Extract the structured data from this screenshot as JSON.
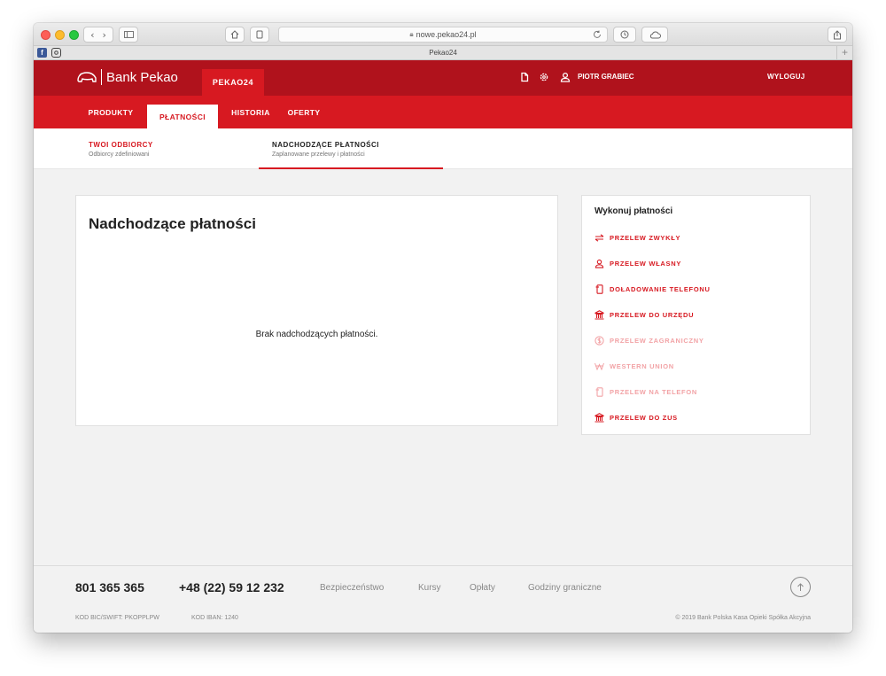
{
  "browser": {
    "url": "nowe.pekao24.pl",
    "tab_title": "Pekao24",
    "new_tab": "+"
  },
  "header": {
    "brand": "Bank Pekao",
    "product_tab": "PEKAO24",
    "user_name": "PIOTR GRABIEC",
    "logout": "WYLOGUJ",
    "icons": [
      "document-icon",
      "settings-icon",
      "user-icon"
    ]
  },
  "nav": {
    "items": [
      "PRODUKTY",
      "PŁATNOŚCI",
      "HISTORIA",
      "OFERTY"
    ],
    "active": "PŁATNOŚCI"
  },
  "subnav": {
    "items": [
      {
        "title": "TWOI ODBIORCY",
        "subtitle": "Odbiorcy zdefiniowani"
      },
      {
        "title": "NADCHODZĄCE PŁATNOŚCI",
        "subtitle": "Zaplanowane przelewy i płatności"
      }
    ],
    "active": "NADCHODZĄCE PŁATNOŚCI"
  },
  "main": {
    "title": "Nadchodzące płatności",
    "empty_message": "Brak nadchodzących płatności."
  },
  "sidebar": {
    "title": "Wykonuj płatności",
    "actions": [
      {
        "label": "PRZELEW ZWYKŁY",
        "icon": "transfer-arrows-icon",
        "enabled": true
      },
      {
        "label": "PRZELEW WŁASNY",
        "icon": "user-icon",
        "enabled": true
      },
      {
        "label": "DOŁADOWANIE TELEFONU",
        "icon": "phone-topup-icon",
        "enabled": true
      },
      {
        "label": "PRZELEW DO URZĘDU",
        "icon": "office-building-icon",
        "enabled": true
      },
      {
        "label": "PRZELEW ZAGRANICZNY",
        "icon": "currency-icon",
        "enabled": false
      },
      {
        "label": "WESTERN UNION",
        "icon": "western-union-icon",
        "enabled": false
      },
      {
        "label": "PRZELEW NA TELEFON",
        "icon": "phone-transfer-icon",
        "enabled": false
      },
      {
        "label": "PRZELEW DO ZUS",
        "icon": "office-building-icon",
        "enabled": true
      }
    ]
  },
  "footer": {
    "phone_primary": "801 365 365",
    "phone_secondary": "+48 (22) 59 12 232",
    "links": [
      "Bezpieczeństwo",
      "Kursy",
      "Opłaty",
      "Godziny graniczne"
    ],
    "bic": "KOD BIC/SWIFT: PKOPPLPW",
    "iban": "KOD IBAN: 1240",
    "copyright": "© 2019 Bank Polska Kasa Opieki Spółka Akcyjna"
  },
  "colors": {
    "brand_dark": "#b0121c",
    "brand": "#d71921",
    "disabled": "#f2a3a6",
    "background": "#f2f2f2"
  }
}
